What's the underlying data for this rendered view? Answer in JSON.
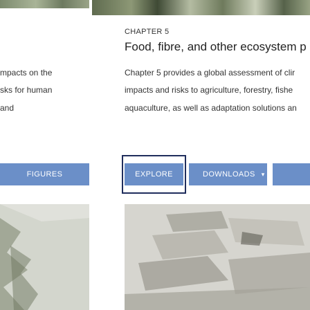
{
  "left_card": {
    "line1": "mpacts on the",
    "line2": "sks for human",
    "line3": "and",
    "button_label": "FIGURES"
  },
  "chapter_card": {
    "label": "CHAPTER 5",
    "title": "Food, fibre, and other ecosystem p",
    "desc_line1": "Chapter 5 provides a global assessment of clir",
    "desc_line2": "impacts and risks to agriculture, forestry, fishe",
    "desc_line3": "aquaculture, as well as adaptation solutions an",
    "explore_label": "EXPLORE",
    "downloads_label": "DOWNLOADS",
    "downloads_caret": "▾"
  },
  "colors": {
    "button_blue": "#6b8fc8",
    "focus_outline": "#1f2d5c"
  }
}
